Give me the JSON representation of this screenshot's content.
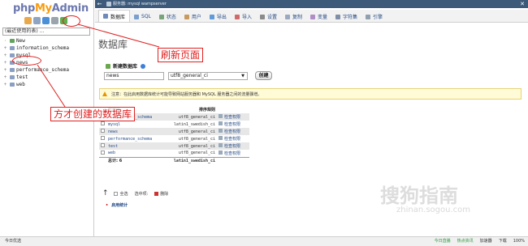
{
  "nav": {
    "logo_php": "php",
    "logo_my": "My",
    "logo_admin": "Admin",
    "db_select_label": "(最近使用的表) ...",
    "tree": [
      {
        "name": "New",
        "kind": "new"
      },
      {
        "name": "information_schema",
        "kind": "db"
      },
      {
        "name": "mysql",
        "kind": "db"
      },
      {
        "name": "news",
        "kind": "db"
      },
      {
        "name": "performance_schema",
        "kind": "db"
      },
      {
        "name": "test",
        "kind": "db"
      },
      {
        "name": "web",
        "kind": "db"
      }
    ]
  },
  "topbar": {
    "breadcrumb": "服务器: mysql wampserver",
    "back_icon": "back-arrow-icon",
    "close_icon": "close-icon"
  },
  "tabs": [
    {
      "label": "数据库",
      "icon": "database-icon",
      "color": "#6d8ab8"
    },
    {
      "label": "SQL",
      "icon": "sql-icon",
      "color": "#7aa0d0"
    },
    {
      "label": "状态",
      "icon": "status-icon",
      "color": "#7aa37a"
    },
    {
      "label": "用户",
      "icon": "users-icon",
      "color": "#c79a5e"
    },
    {
      "label": "导出",
      "icon": "export-icon",
      "color": "#5f9ad9"
    },
    {
      "label": "导入",
      "icon": "import-icon",
      "color": "#d06a6a"
    },
    {
      "label": "设置",
      "icon": "settings-icon",
      "color": "#8a8a8a"
    },
    {
      "label": "复制",
      "icon": "replication-icon",
      "color": "#9aa9c0"
    },
    {
      "label": "变量",
      "icon": "variables-icon",
      "color": "#b08dc7"
    },
    {
      "label": "字符集",
      "icon": "charset-icon",
      "color": "#7f8fa8"
    },
    {
      "label": "引擎",
      "icon": "engines-icon",
      "color": "#90a0b0"
    }
  ],
  "main": {
    "title": "数据库",
    "new_db_label": "新建数据库",
    "db_name_value": "news",
    "collation_value": "utf8_general_ci",
    "create_button": "创建",
    "notice": "注意：在此启用数据库统计可能导致网站服务器和 MySQL 服务器之间的流量骤增。",
    "table": {
      "headers": [
        "数据库",
        "排序规则"
      ],
      "rows": [
        {
          "name": "information_schema",
          "collation": "utf8_general_ci",
          "priv": "检查权限"
        },
        {
          "name": "mysql",
          "collation": "latin1_swedish_ci",
          "priv": "检查权限"
        },
        {
          "name": "news",
          "collation": "utf8_general_ci",
          "priv": "检查权限"
        },
        {
          "name": "performance_schema",
          "collation": "utf8_general_ci",
          "priv": "检查权限"
        },
        {
          "name": "test",
          "collation": "utf8_general_ci",
          "priv": "检查权限"
        },
        {
          "name": "web",
          "collation": "utf8_general_ci",
          "priv": "检查权限"
        }
      ],
      "total_label": "总计: 6",
      "total_collation": "latin1_swedish_ci"
    },
    "select_all": "全选",
    "with_selected": "选中项:",
    "delete": "删除",
    "enable_stats": "启用统计"
  },
  "annotations": {
    "refresh_label": "刷新页面",
    "created_db_label": "方才创建的数据库"
  },
  "statusbar": {
    "left": "今日优选",
    "right": [
      "今日直播",
      "热点资讯",
      "加速器",
      "下载",
      "100%"
    ]
  },
  "watermark": {
    "main": "搜狗指南",
    "sub": "zhinan.sogou.com"
  }
}
